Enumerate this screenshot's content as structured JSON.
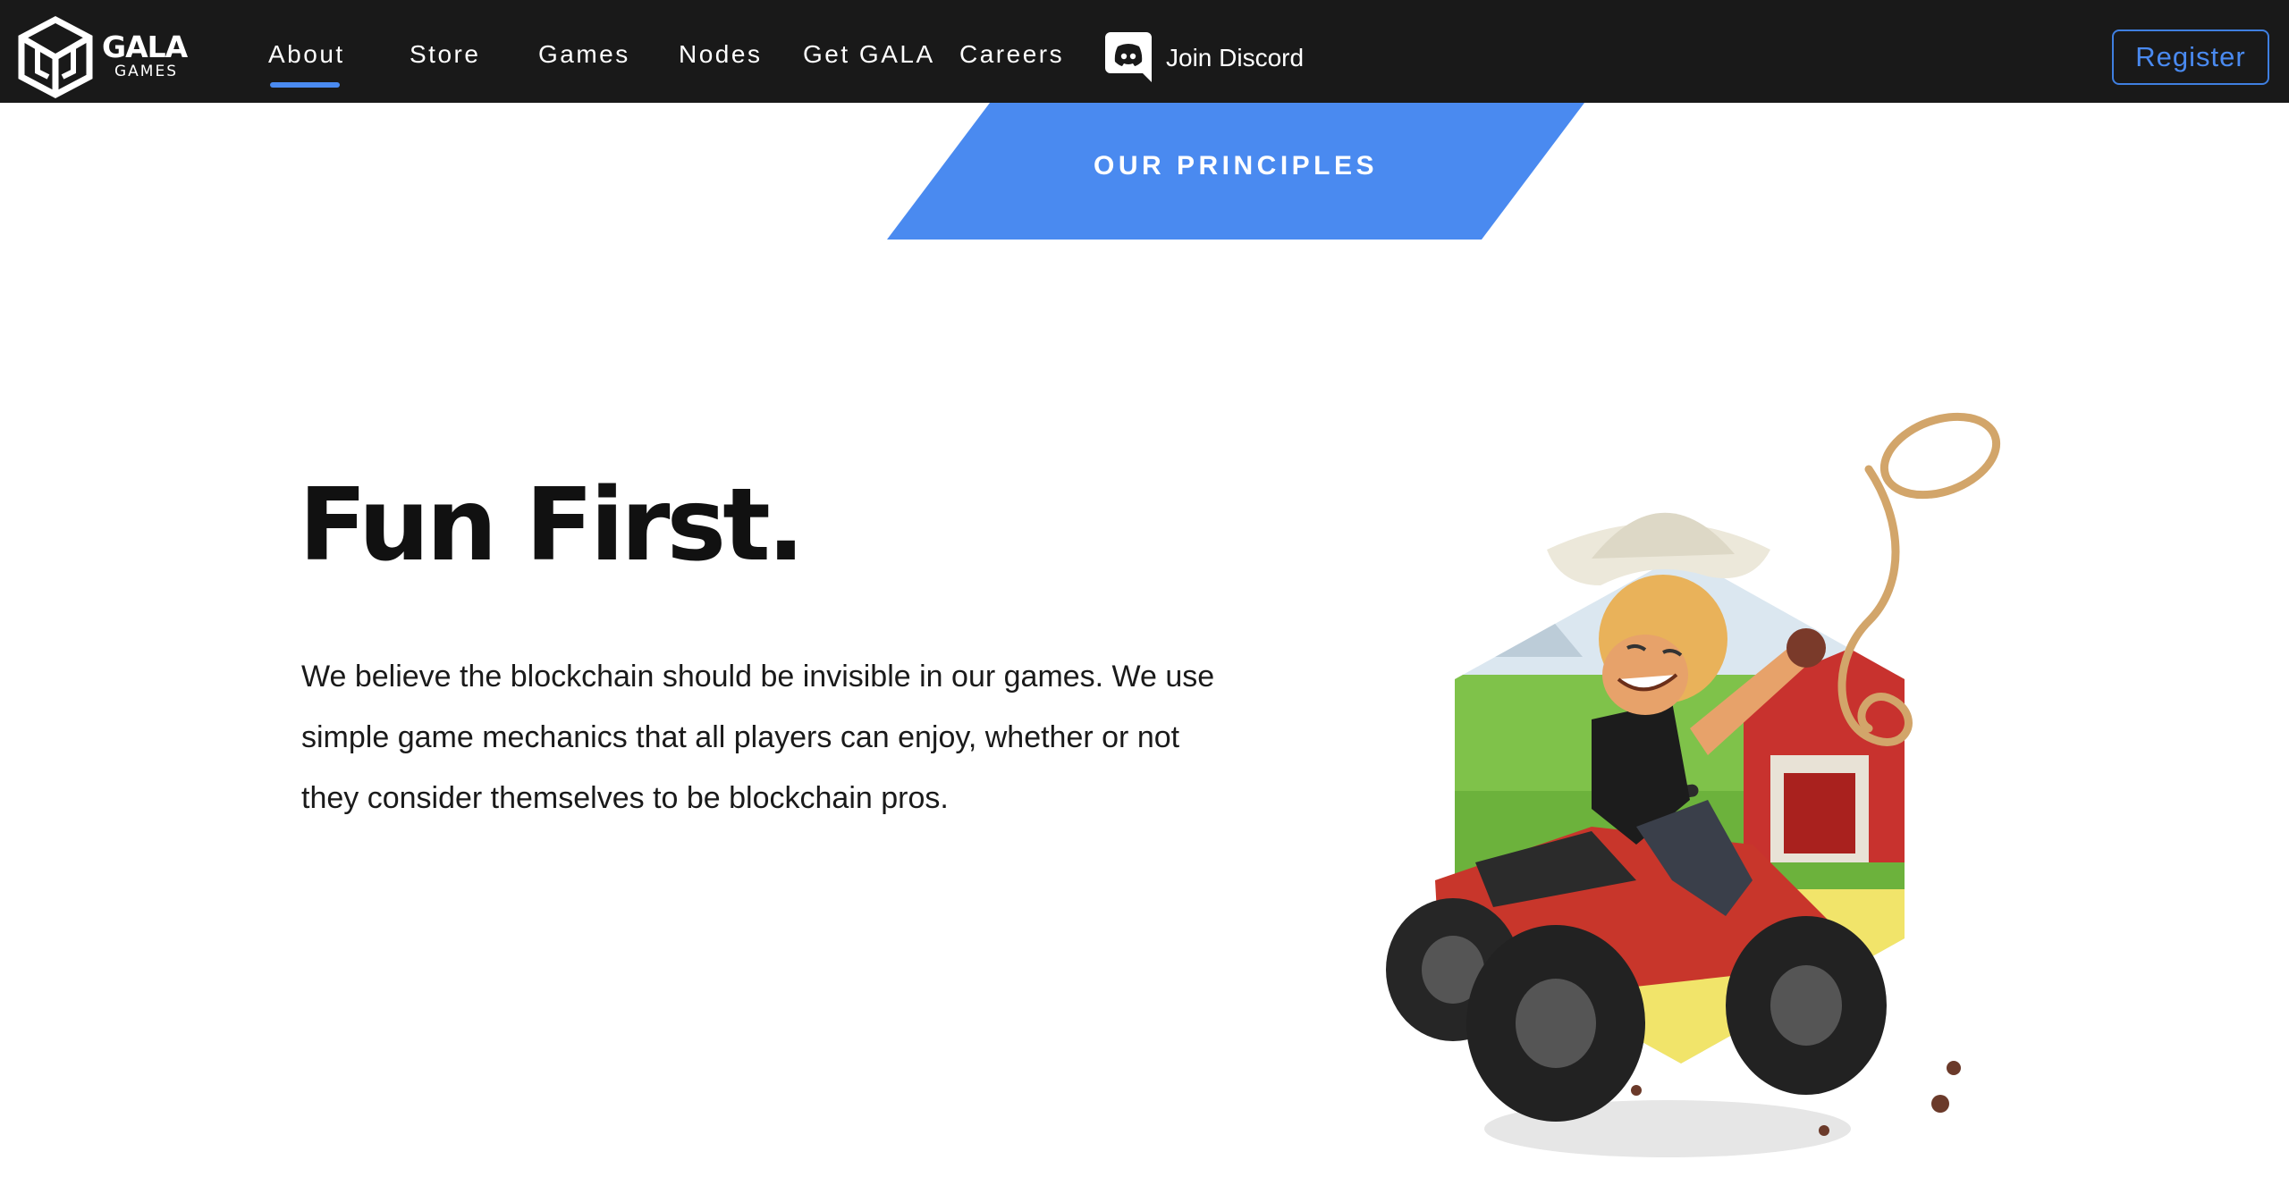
{
  "brand": {
    "name": "GALA",
    "sub": "GAMES",
    "logo_icon": "gala-cube-logo-icon"
  },
  "nav": {
    "items": [
      {
        "label": "About",
        "active": true
      },
      {
        "label": "Store",
        "active": false
      },
      {
        "label": "Games",
        "active": false
      },
      {
        "label": "Nodes",
        "active": false
      },
      {
        "label": "Get GALA",
        "active": false
      },
      {
        "label": "Careers",
        "active": false
      }
    ],
    "discord": {
      "label": "Join Discord",
      "icon": "discord-icon"
    },
    "register_label": "Register"
  },
  "banner": {
    "label": "OUR PRINCIPLES"
  },
  "principle": {
    "title": "Fun First.",
    "description": "We believe the blockchain should be invisible in our games. We use simple game mechanics that all players can enjoy, whether or not they consider themselves to be blockchain pros."
  },
  "colors": {
    "nav_bg": "#191919",
    "accent_blue": "#4a8af0",
    "text_dark": "#111111"
  }
}
